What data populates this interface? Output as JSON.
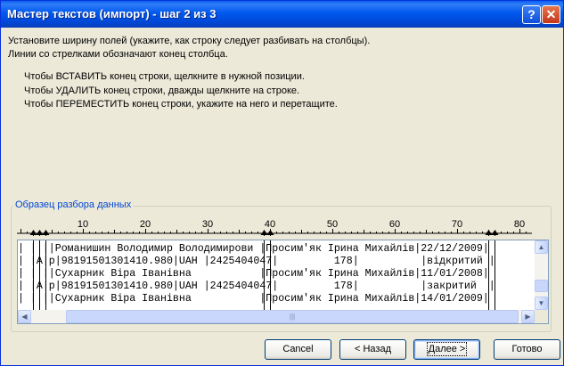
{
  "window": {
    "title": "Мастер текстов (импорт) - шаг 2 из 3",
    "help_glyph": "?",
    "close_glyph": "✕"
  },
  "instructions": {
    "line1": "Установите ширину полей (укажите, как строку следует разбивать на столбцы).",
    "line2": "Линии со стрелками обозначают конец столбца.",
    "hint1": "Чтобы ВСТАВИТЬ конец строки, щелкните в нужной позиции.",
    "hint2": "Чтобы УДАЛИТЬ конец строки, дважды щелкните на строке.",
    "hint3": "Чтобы ПЕРЕМЕСТИТЬ конец строки, укажите на него и перетащите."
  },
  "preview": {
    "label": "Образец разбора данных",
    "ruler_ticks": [
      "10",
      "20",
      "30",
      "40",
      "50",
      "60",
      "70",
      "80"
    ],
    "break_positions": [
      2,
      3,
      4,
      39,
      40,
      75,
      76
    ],
    "rows": [
      "| | ||Романишин Володимир Володимирови |Просим'як Ірина Михайлів|22/12/2009|",
      "| |А|р|98191501301410.980|UAH |2425404047|         178|          |відкритий |",
      "| | ||Сухарник Віра Іванівна           |Просим'як Ірина Михайлів|11/01/2008|",
      "| |А|р|98191501301410.980|UAH |2425404047|         178|          |закритий  |",
      "| | ||Сухарник Віра Іванівна           |Просим'як Ірина Михайлів|14/01/2009|"
    ]
  },
  "buttons": {
    "cancel": "Cancel",
    "back": "< Назад",
    "next": "Далее >",
    "finish": "Готово"
  }
}
